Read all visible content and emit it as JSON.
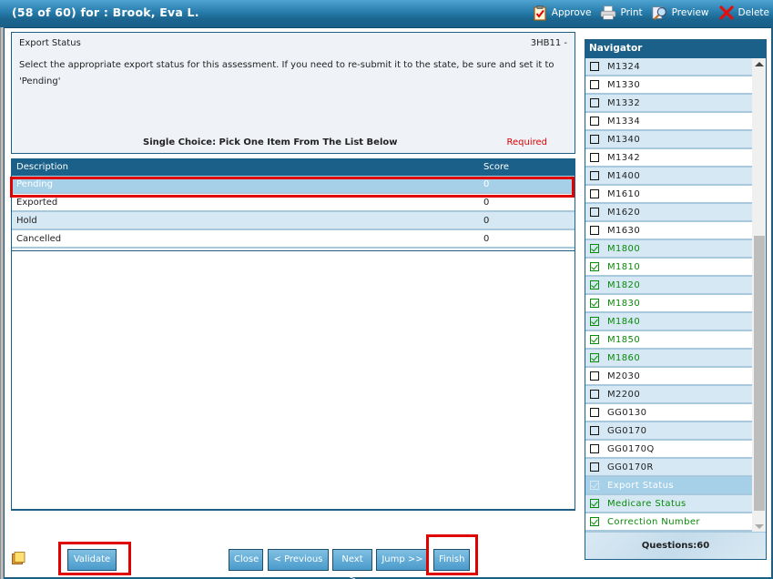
{
  "window": {
    "title": "(58 of 60) for : Brook, Eva L."
  },
  "toolbar": {
    "items": [
      {
        "label": "Approve",
        "icon": "clipboard-check-icon"
      },
      {
        "label": "Print",
        "icon": "printer-icon"
      },
      {
        "label": "Preview",
        "icon": "magnifier-preview-icon"
      },
      {
        "label": "Delete",
        "icon": "red-x-icon"
      }
    ]
  },
  "question": {
    "title": "Export Status",
    "code": "3HB11 -",
    "text": "Select the appropriate export status for this assessment. If you need to re-submit it to the state, be sure and set it to 'Pending'",
    "choice_type": "Single Choice: Pick One Item From The List Below",
    "required": "Required"
  },
  "answers": {
    "headers": {
      "description": "Description",
      "score": "Score"
    },
    "rows": [
      {
        "description": "Pending",
        "score": "0",
        "selected": true
      },
      {
        "description": "Exported",
        "score": "0",
        "selected": false
      },
      {
        "description": "Hold",
        "score": "0",
        "selected": false
      },
      {
        "description": "Cancelled",
        "score": "0",
        "selected": false
      }
    ]
  },
  "navigator": {
    "title": "Navigator",
    "items": [
      {
        "label": "M1324",
        "checked": false
      },
      {
        "label": "M1330",
        "checked": false
      },
      {
        "label": "M1332",
        "checked": false
      },
      {
        "label": "M1334",
        "checked": false
      },
      {
        "label": "M1340",
        "checked": false
      },
      {
        "label": "M1342",
        "checked": false
      },
      {
        "label": "M1400",
        "checked": false
      },
      {
        "label": "M1610",
        "checked": false
      },
      {
        "label": "M1620",
        "checked": false
      },
      {
        "label": "M1630",
        "checked": false
      },
      {
        "label": "M1800",
        "checked": true
      },
      {
        "label": "M1810",
        "checked": true
      },
      {
        "label": "M1820",
        "checked": true
      },
      {
        "label": "M1830",
        "checked": true
      },
      {
        "label": "M1840",
        "checked": true
      },
      {
        "label": "M1850",
        "checked": true
      },
      {
        "label": "M1860",
        "checked": true
      },
      {
        "label": "M2030",
        "checked": false
      },
      {
        "label": "M2200",
        "checked": false
      },
      {
        "label": "GG0130",
        "checked": false
      },
      {
        "label": "GG0170",
        "checked": false
      },
      {
        "label": "GG0170Q",
        "checked": false
      },
      {
        "label": "GG0170R",
        "checked": false
      },
      {
        "label": "Export Status",
        "checked": true,
        "current": true
      },
      {
        "label": "Medicare Status",
        "checked": true
      },
      {
        "label": "Correction Number",
        "checked": true
      }
    ],
    "footer": "Questions:60"
  },
  "buttons": {
    "validate": "Validate",
    "close": "Close",
    "previous": "< Previous",
    "next": "Next >",
    "jump": "Jump >>",
    "finish": "Finish"
  },
  "colors": {
    "header_blue": "#1a6088",
    "selected_row": "#a5d0e8",
    "alt_row": "#d5e8f4",
    "completed_green": "#0a8a0a",
    "required_red": "#e00000",
    "highlight_red": "#e00000"
  }
}
